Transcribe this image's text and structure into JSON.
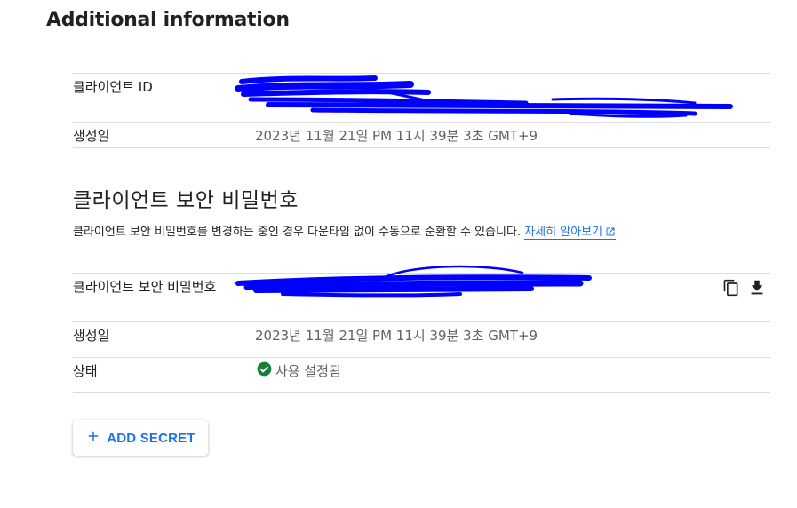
{
  "page": {
    "heading": "Additional information"
  },
  "client_info": {
    "client_id_label": "클라이언트 ID",
    "created_label": "생성일",
    "created_value": "2023년 11월 21일 PM 11시 39분 3초 GMT+9"
  },
  "secret_section": {
    "title": "클라이언트 보안 비밀번호",
    "description": "클라이언트 보안 비밀번호를 변경하는 중인 경우 다운타임 없이 수동으로 순환할 수 있습니다.",
    "learn_more": "자세히 알아보기",
    "secret_label": "클라이언트 보안 비밀번호",
    "created_label": "생성일",
    "created_value": "2023년 11월 21일 PM 11시 39분 3초 GMT+9",
    "status_label": "상태",
    "status_value": "사용 설정됨",
    "add_secret_button": "ADD SECRET"
  },
  "icons": {
    "copy": "copy-icon",
    "download": "download-icon",
    "external_link": "external-link-icon",
    "check_circle": "check-circle-icon",
    "plus": "plus-icon"
  },
  "colors": {
    "accent": "#1a73e8",
    "success": "#188038",
    "redaction": "#0000ff"
  }
}
